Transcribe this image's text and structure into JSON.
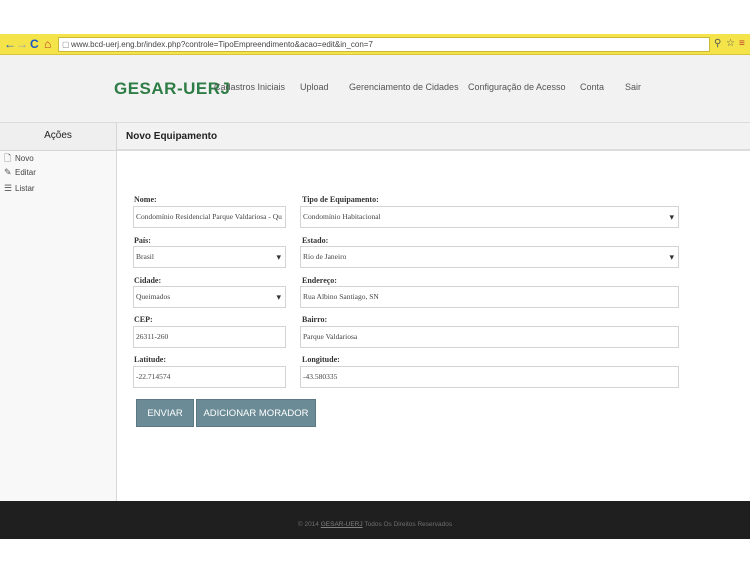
{
  "browser": {
    "url": "www.bcd-uerj.eng.br/index.php?controle=TipoEmpreendimento&acao=edit&in_con=7",
    "back_glyph": "←",
    "forward_glyph": "→",
    "reload_glyph": "C",
    "home_glyph": "⌂",
    "page_glyph": "▢",
    "zoom_glyph": "⚲",
    "star_glyph": "☆",
    "menu_glyph": "≡"
  },
  "header": {
    "logo": "GESAR-UERJ",
    "menu": [
      "Cadastros Iniciais",
      "Upload",
      "Gerenciamento de Cidades",
      "Configuração de Acesso",
      "Conta",
      "Sair"
    ]
  },
  "sidebar": {
    "title": "Ações",
    "items": [
      {
        "label": "Novo",
        "icon": "new-file-icon",
        "glyph": "🗋"
      },
      {
        "label": "Editar",
        "icon": "pencil-icon",
        "glyph": "✎"
      },
      {
        "label": "Listar",
        "icon": "list-icon",
        "glyph": "☰"
      }
    ]
  },
  "panel": {
    "title": "Novo Equipamento"
  },
  "form": {
    "nome": {
      "label": "Nome:",
      "value": "Condomínio Residencial Parque Valdariosa - Qu"
    },
    "tipo": {
      "label": "Tipo de Equipamento:",
      "value": "Condomínio Habitacional"
    },
    "pais": {
      "label": "País:",
      "value": "Brasil"
    },
    "estado": {
      "label": "Estado:",
      "value": "Rio de Janeiro"
    },
    "cidade": {
      "label": "Cidade:",
      "value": "Queimados"
    },
    "endereco": {
      "label": "Endereço:",
      "value": "Rua Albino Santiago, SN"
    },
    "cep": {
      "label": "CEP:",
      "value": "26311-260"
    },
    "bairro": {
      "label": "Bairro:",
      "value": "Parque Valdariosa"
    },
    "latitude": {
      "label": "Latitude:",
      "value": "-22.714574"
    },
    "longitude": {
      "label": "Longitude:",
      "value": "-43.580335"
    }
  },
  "buttons": {
    "enviar": "ENVIAR",
    "adicionar": "ADICIONAR MORADOR"
  },
  "footer": {
    "prefix": "© 2014",
    "link": "GESAR-UERJ",
    "suffix": "Todos Os Direitos Reservados"
  },
  "colors": {
    "brand": "#2e7d46",
    "browser_bar": "#f5e34a",
    "button": "#6b8b96",
    "footer": "#1f1f1f"
  }
}
